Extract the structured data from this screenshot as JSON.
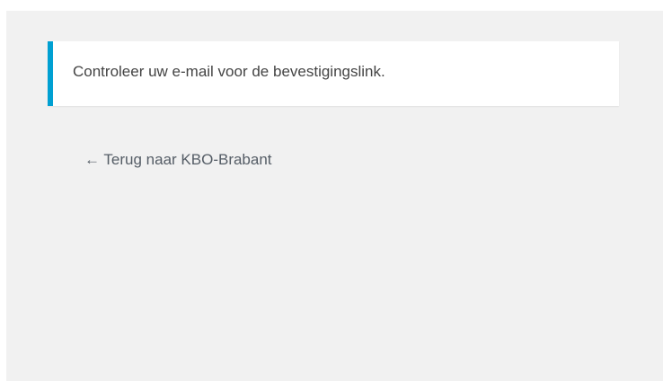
{
  "notice": {
    "message": "Controleer uw e-mail voor de bevestigingslink.",
    "accent_color": "#00a0d2"
  },
  "back_link": {
    "label": "← Terug naar KBO-Brabant"
  },
  "colors": {
    "page_background": "#f1f1f1",
    "notice_background": "#ffffff",
    "text": "#444444"
  }
}
